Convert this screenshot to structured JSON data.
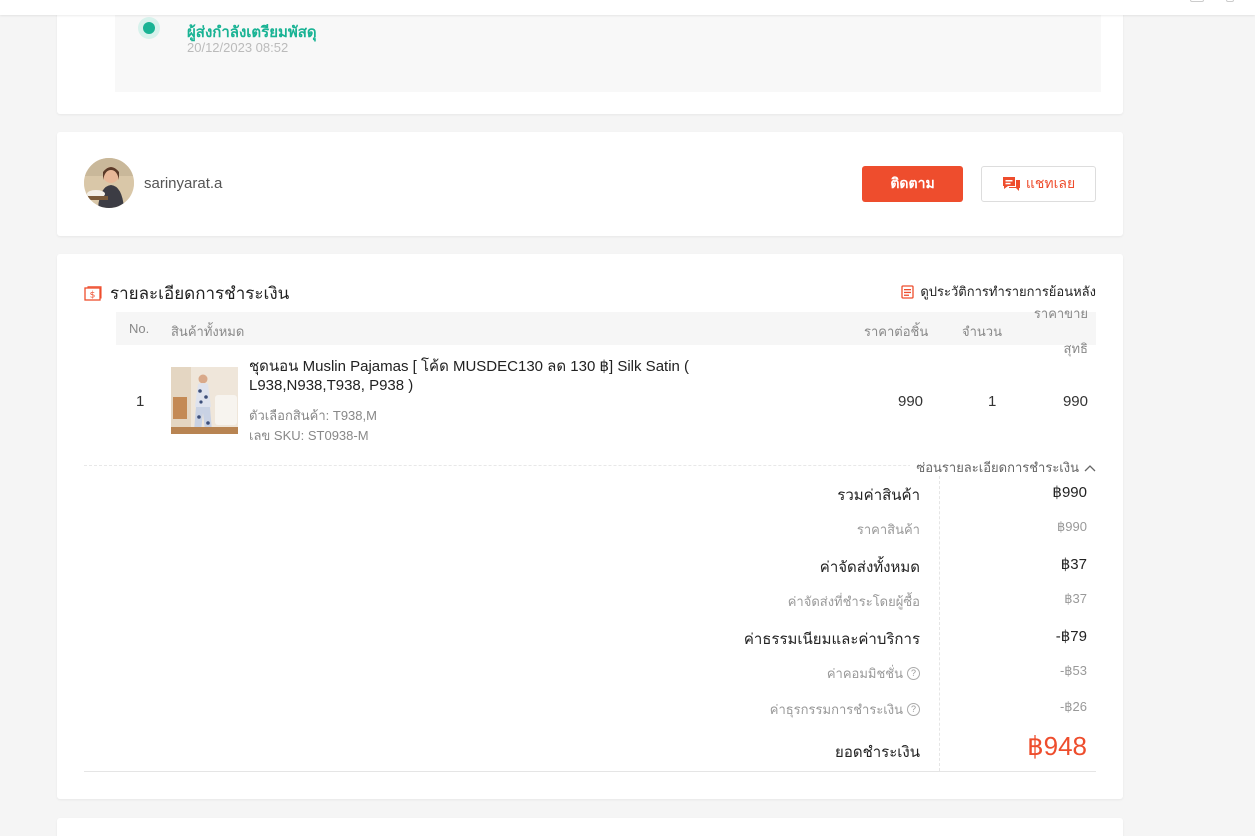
{
  "colors": {
    "accent": "#ee4d2d",
    "status_green": "#19b394"
  },
  "tracking": {
    "status": "ผู้ส่งกำลังเตรียมพัสดุ",
    "time": "20/12/2023 08:52"
  },
  "buyer": {
    "username": "sarinyarat.a",
    "follow_label": "ติดตาม",
    "chat_label": "แชทเลย"
  },
  "payment": {
    "title": "รายละเอียดการชำระเงิน",
    "history_link": "ดูประวัติการทำรายการย้อนหลัง",
    "columns": {
      "no": "No.",
      "product": "สินค้าทั้งหมด",
      "unit_price": "ราคาต่อชิ้น",
      "qty": "จำนวน",
      "net_line1": "ราคาขาย",
      "net_line2": "สุทธิ"
    },
    "items": [
      {
        "no": "1",
        "name": "ชุดนอน Muslin Pajamas [ โค้ด MUSDEC130 ลด 130 ฿] Silk Satin ( L938,N938,T938, P938 )",
        "variation": "ตัวเลือกสินค้า: T938,M",
        "sku": "เลข SKU: ST0938-M",
        "unit_price": "990",
        "qty": "1",
        "net": "990"
      }
    ],
    "toggle_label": "ซ่อนรายละเอียดการชำระเงิน",
    "summary": {
      "merch_total_label": "รวมค่าสินค้า",
      "merch_total": "฿990",
      "product_price_label": "ราคาสินค้า",
      "product_price": "฿990",
      "shipping_total_label": "ค่าจัดส่งทั้งหมด",
      "shipping_total": "฿37",
      "shipping_buyer_label": "ค่าจัดส่งที่ชำระโดยผู้ซื้อ",
      "shipping_buyer": "฿37",
      "fees_label": "ค่าธรรมเนียมและค่าบริการ",
      "fees": "-฿79",
      "commission_label": "ค่าคอมมิชชั่น",
      "commission": "-฿53",
      "transaction_label": "ค่าธุรกรรมการชำระเงิน",
      "transaction": "-฿26",
      "grand_label": "ยอดชำระเงิน",
      "grand": "฿948"
    }
  }
}
